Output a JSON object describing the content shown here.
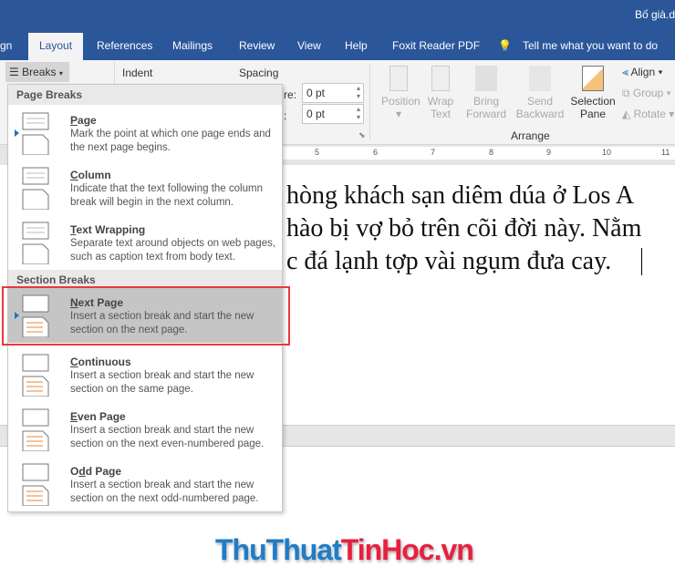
{
  "window": {
    "title": "Bố già.d"
  },
  "tabs": [
    {
      "label": "gn"
    },
    {
      "label": "Layout",
      "active": true
    },
    {
      "label": "References"
    },
    {
      "label": "Mailings"
    },
    {
      "label": "Review"
    },
    {
      "label": "View"
    },
    {
      "label": "Help"
    },
    {
      "label": "Foxit Reader PDF"
    },
    {
      "label": "Tell me what you want to do"
    }
  ],
  "ribbon": {
    "breaks": "Breaks",
    "indent": "Indent",
    "spacing": "Spacing",
    "before_label": "re:",
    "before_value": "0 pt",
    "after_label": ":",
    "after_value": "0 pt",
    "arrange": {
      "group_label": "Arrange",
      "position": "Position",
      "wrap": "Wrap",
      "wrap2": "Text",
      "bring": "Bring",
      "bring2": "Forward",
      "send": "Send",
      "send2": "Backward",
      "selection": "Selection",
      "selection2": "Pane",
      "align": "Align",
      "group": "Group",
      "rotate": "Rotate"
    }
  },
  "ruler": [
    "5",
    "6",
    "7",
    "8",
    "9",
    "10",
    "11"
  ],
  "document": {
    "lines": [
      "hòng khách sạn diêm dúa ở Los A",
      "hào bị vợ bỏ trên cõi đời này. Nằm",
      "c đá lạnh tợp vài ngụm đưa cay."
    ]
  },
  "menu": {
    "page_breaks_header": "Page Breaks",
    "section_breaks_header": "Section Breaks",
    "items": [
      {
        "key": "P",
        "rest": "age",
        "desc": "Mark the point at which one page ends and the next page begins.",
        "icon": "page-break-icon"
      },
      {
        "key": "C",
        "rest": "olumn",
        "desc": "Indicate that the text following the column break will begin in the next column.",
        "icon": "column-break-icon"
      },
      {
        "key": "T",
        "rest": "ext Wrapping",
        "desc": "Separate text around objects on web pages, such as caption text from body text.",
        "icon": "text-wrapping-icon"
      },
      {
        "key": "N",
        "rest": "ext Page",
        "desc": "Insert a section break and start the new section on the next page.",
        "icon": "next-page-icon",
        "selected": true
      },
      {
        "key": "C",
        "rest": "ontinuous",
        "desc": "Insert a section break and start the new section on the same page.",
        "icon": "continuous-icon"
      },
      {
        "key": "E",
        "rest": "ven Page",
        "desc": "Insert a section break and start the new section on the next even-numbered page.",
        "icon": "even-page-icon"
      },
      {
        "pre": "O",
        "key": "d",
        "rest": "d Page",
        "desc": "Insert a section break and start the new section on the next odd-numbered page.",
        "icon": "odd-page-icon"
      }
    ]
  },
  "logo": {
    "part1": "ThuThuat",
    "part2": "TinHoc",
    "part3": ".vn"
  },
  "colors": {
    "title_bar": "#2b579a",
    "highlight_border": "#e8383d",
    "logo_blue": "#1e7cc8",
    "logo_red": "#e8203f",
    "accent_orange": "#e8873a"
  }
}
